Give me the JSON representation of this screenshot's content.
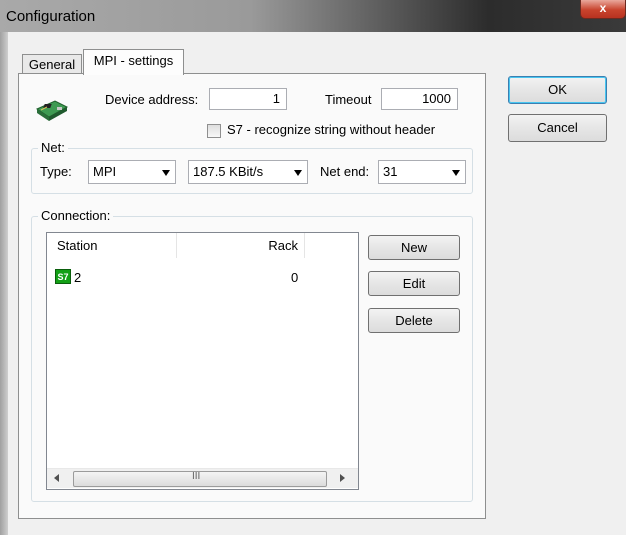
{
  "window": {
    "title": "Configuration",
    "close_label": "x"
  },
  "tabs": [
    {
      "label": "General"
    },
    {
      "label": "MPI - settings"
    }
  ],
  "buttons": {
    "ok": "OK",
    "cancel": "Cancel",
    "new": "New",
    "edit": "Edit",
    "delete": "Delete"
  },
  "device": {
    "address_label": "Device address:",
    "address_value": "1",
    "timeout_label": "Timeout",
    "timeout_value": "1000",
    "s7_checkbox_label": "S7 - recognize string without header",
    "s7_checked": false
  },
  "net": {
    "legend": "Net:",
    "type_label": "Type:",
    "type_value": "MPI",
    "speed_value": "187.5 KBit/s",
    "net_end_label": "Net end:",
    "net_end_value": "31"
  },
  "connection": {
    "legend": "Connection:",
    "columns": [
      "Station",
      "Rack"
    ],
    "rows": [
      {
        "icon": "S7",
        "station": "2",
        "rack": "0"
      }
    ],
    "scroll_mid": "III"
  }
}
